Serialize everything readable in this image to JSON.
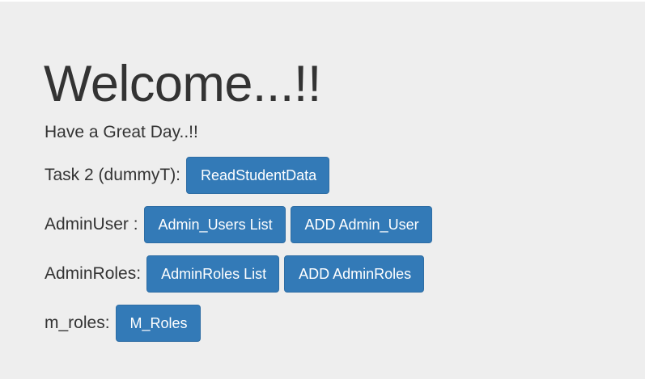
{
  "header": {
    "title": "Welcome...!!",
    "subtitle": "Have a Great Day..!!"
  },
  "sections": {
    "task2": {
      "label": "Task 2 (dummyT):",
      "buttons": [
        "ReadStudentData"
      ]
    },
    "admin_user": {
      "label": "AdminUser :",
      "buttons": [
        "Admin_Users List",
        "ADD Admin_User"
      ]
    },
    "admin_roles": {
      "label": "AdminRoles:",
      "buttons": [
        "AdminRoles List",
        "ADD AdminRoles"
      ]
    },
    "m_roles": {
      "label": "m_roles:",
      "buttons": [
        "M_Roles"
      ]
    }
  },
  "colors": {
    "background": "#eeeeee",
    "text": "#333333",
    "button_primary": "#337ab7",
    "button_border": "#2e6da4",
    "button_text": "#ffffff"
  }
}
